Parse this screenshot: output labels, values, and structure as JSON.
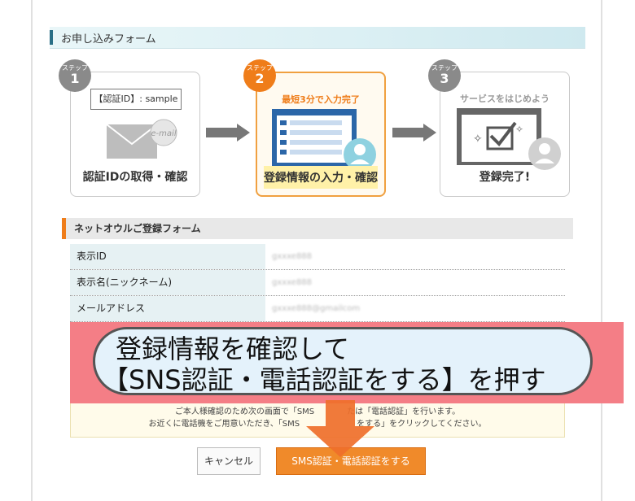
{
  "form_title": "お申し込みフォーム",
  "steps": [
    {
      "small": "ステップ",
      "num": "1",
      "caption": "認証IDの取得・確認",
      "id_box": "【認証ID】: sample",
      "envelope_label": "e-mail"
    },
    {
      "small": "ステップ",
      "num": "2",
      "caption": "登録情報の入力・確認",
      "tagline": "最短3分で入力完了"
    },
    {
      "small": "ステップ",
      "num": "3",
      "caption": "登録完了!",
      "tagline": "サービスをはじめよう"
    }
  ],
  "section_title": "ネットオウルご登録フォーム",
  "rows": [
    {
      "label": "表示ID",
      "value": "gxxxe888"
    },
    {
      "label": "表示名(ニックネーム)",
      "value": "gxxxe888"
    },
    {
      "label": "メールアドレス",
      "value": "gxxxe888@gmailcom"
    }
  ],
  "overlay": {
    "line1": "登録情報を確認して",
    "line2": "【SNS認証・電話認証をする】を押す"
  },
  "notice": {
    "line1": "ご本人様確認のため次の画面で「SMS　　　　たは「電話認証」を行います。",
    "line2": "お近くに電話機をご用意いただき、「SMS　　　　　　　をする」をクリックしてください。"
  },
  "buttons": {
    "cancel": "キャンセル",
    "sms": "SMS認証・電話認証をする"
  },
  "colors": {
    "accent_orange": "#ef7d1a",
    "overlay_red": "#f47e86",
    "header_teal": "#2a6f86"
  }
}
